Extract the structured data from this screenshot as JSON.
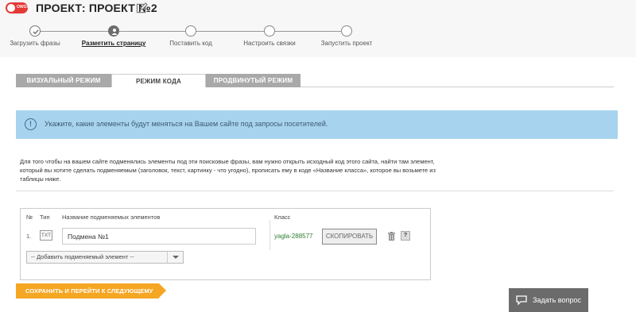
{
  "header": {
    "logo_text": "OWOX",
    "title": "ПРОЕКТ: ПРОЕКТ №2"
  },
  "steps": [
    {
      "label": "Загрузить фразы",
      "state": "done"
    },
    {
      "label": "Разметить страницу",
      "state": "active"
    },
    {
      "label": "Поставить код",
      "state": "pending"
    },
    {
      "label": "Настроить связки",
      "state": "pending"
    },
    {
      "label": "Запустить проект",
      "state": "pending"
    }
  ],
  "tabs": [
    {
      "label": "ВИЗУАЛЬНЫЙ РЕЖИМ",
      "active": false
    },
    {
      "label": "РЕЖИМ КОДА",
      "active": true
    },
    {
      "label": "ПРОДВИНУТЫЙ РЕЖИМ",
      "active": false
    }
  ],
  "info": {
    "icon": "!",
    "text": "Укажите, какие элементы будут меняться на Вашем сайте под запросы посетителей."
  },
  "description": "Для того чтобы на вашем сайте подменялись элементы под эти поисковые фразы, вам нужно открыть исходный код этого сайта, найти там элемент, который вы хотите сделать подменяемым (заголовок, текст, картинку - что угодно), прописать ему в коде «Название класса», которое вы возьмете из таблицы ниже.",
  "table": {
    "headers": {
      "num": "№",
      "type": "Тип",
      "name": "Название подменяемых элементов",
      "class": "Класс"
    },
    "rows": [
      {
        "num": "1.",
        "type": "TXT",
        "name": "Подмена №1",
        "class": "yagla-288577",
        "copy_label": "СКОПИРОВАТЬ",
        "help_label": "?"
      }
    ],
    "add_select": "-- Добавить подменяемый элемент --"
  },
  "save_button": "СОХРАНИТЬ И ПЕРЕЙТИ К СЛЕДУЮЩЕМУ ШАГУ",
  "chat_button": "Задать вопрос",
  "colors": {
    "accent": "#f5a623",
    "info_bg": "#a8d3ef",
    "class_text": "#2e7d32",
    "logo": "#e53935"
  }
}
